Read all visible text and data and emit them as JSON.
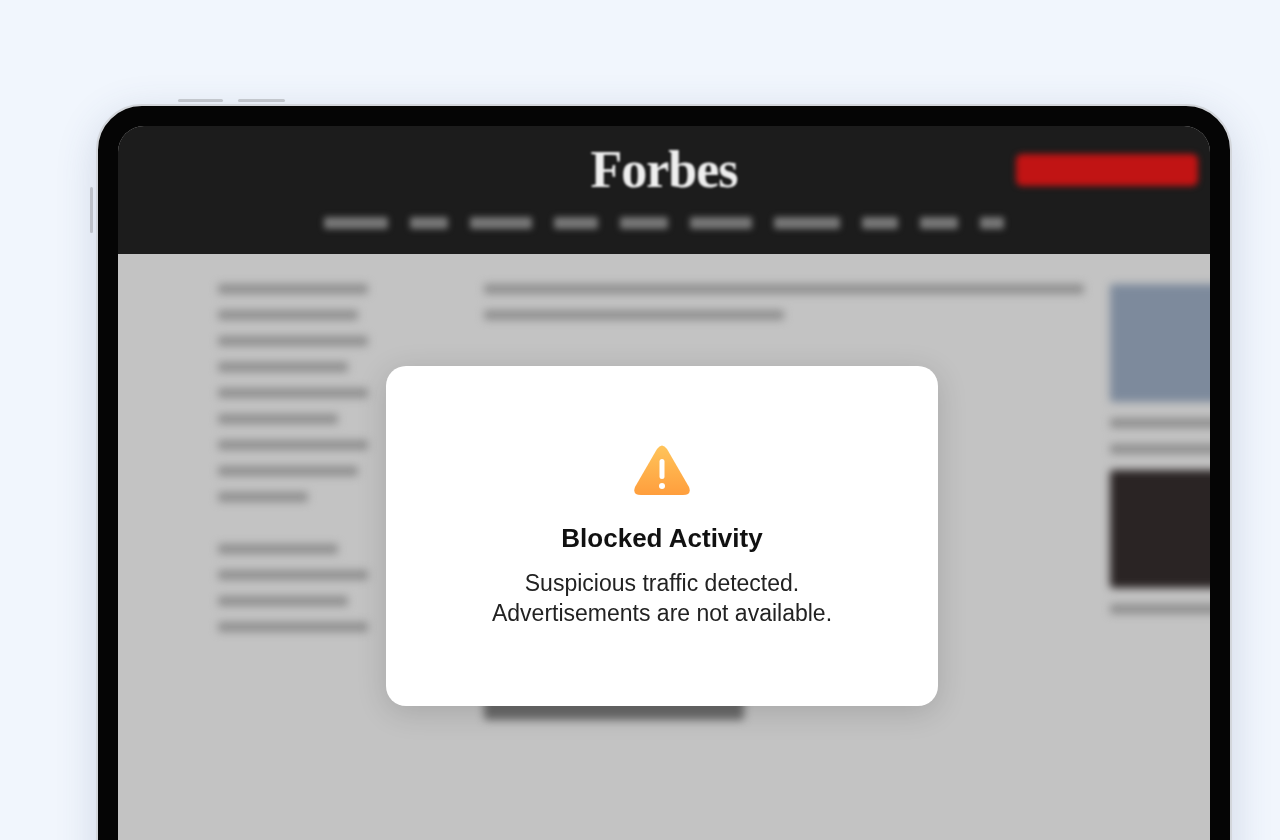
{
  "masthead": {
    "logo": "Forbes"
  },
  "dialog": {
    "title": "Blocked Activity",
    "message_lines": [
      "Suspicious traffic detected.",
      "Advertisements are not available."
    ]
  }
}
